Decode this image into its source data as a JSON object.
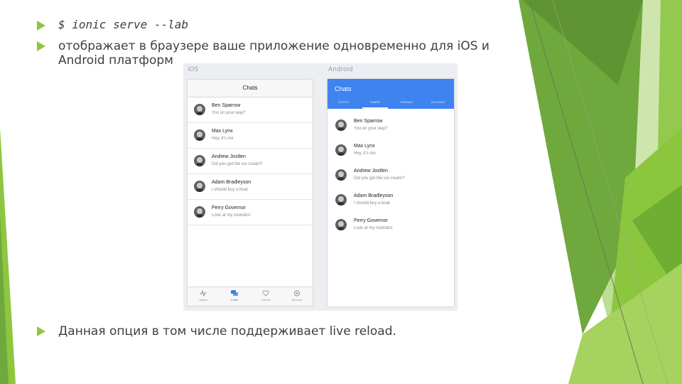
{
  "bullets": [
    {
      "text": "$ ionic serve --lab"
    },
    {
      "text_line1": "отображает в браузере ваше приложение одновременно для iOS и",
      "text_line2": "Android платформ"
    },
    {
      "text": "Данная опция в том числе поддерживает live reload."
    }
  ],
  "screenshot": {
    "ios_label": "iOS",
    "android_label": "Android",
    "ios": {
      "nav_title": "Chats",
      "tabs": [
        {
          "label": "Status",
          "icon": "pulse-icon"
        },
        {
          "label": "Chats",
          "icon": "chat-bubbles-icon"
        },
        {
          "label": "Friends",
          "icon": "heart-icon"
        },
        {
          "label": "Account",
          "icon": "gear-icon"
        }
      ]
    },
    "android": {
      "title": "Chats",
      "tabs": [
        "STATUS",
        "CHATS",
        "FRIENDS",
        "ACCOUNT"
      ]
    },
    "chats": [
      {
        "name": "Ben Sparrow",
        "message": "You on your way?"
      },
      {
        "name": "Max Lynx",
        "message": "Hey, it's me"
      },
      {
        "name": "Andrew Jostlen",
        "message": "Did you get the ice cream?"
      },
      {
        "name": "Adam Bradleyson",
        "message": "I should buy a boat"
      },
      {
        "name": "Perry Governor",
        "message": "Look at my mukluks!"
      }
    ]
  },
  "colors": {
    "accent_green": "#8dc63f",
    "dark_green": "#5a9e2f",
    "android_blue": "#3f83ef",
    "ios_active": "#3b7ddd"
  }
}
